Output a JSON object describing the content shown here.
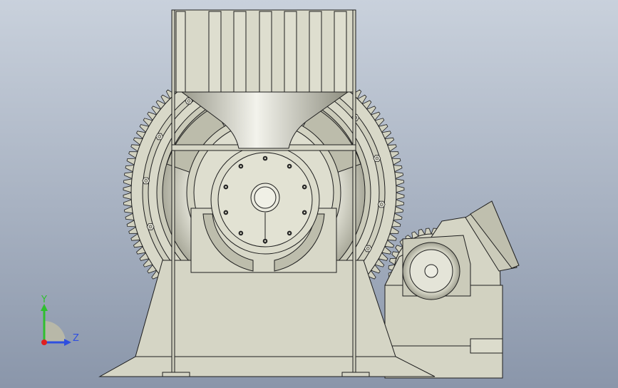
{
  "viewport": {
    "background_top": "#c7cfdb",
    "background_bottom": "#8c98ab",
    "model_fill": "#d9d9c9",
    "model_shade": "#c9c9b8",
    "model_dark": "#a5a596",
    "edge_color": "#1e1e1e",
    "white_highlight": "#f4f4f0"
  },
  "model": {
    "name": "grinding-mill-assembly",
    "parts": [
      "hopper",
      "support-frame",
      "mill-drum",
      "ring-gear",
      "pinion-gear",
      "drive-motor",
      "base-plinth"
    ]
  },
  "triad": {
    "axes": [
      {
        "name": "Y",
        "color": "#2fbf2f"
      },
      {
        "name": "Z",
        "color": "#2f4fe0"
      },
      {
        "name": "X",
        "color": "#e02020"
      }
    ],
    "y_label": "Y",
    "z_label": "Z"
  }
}
